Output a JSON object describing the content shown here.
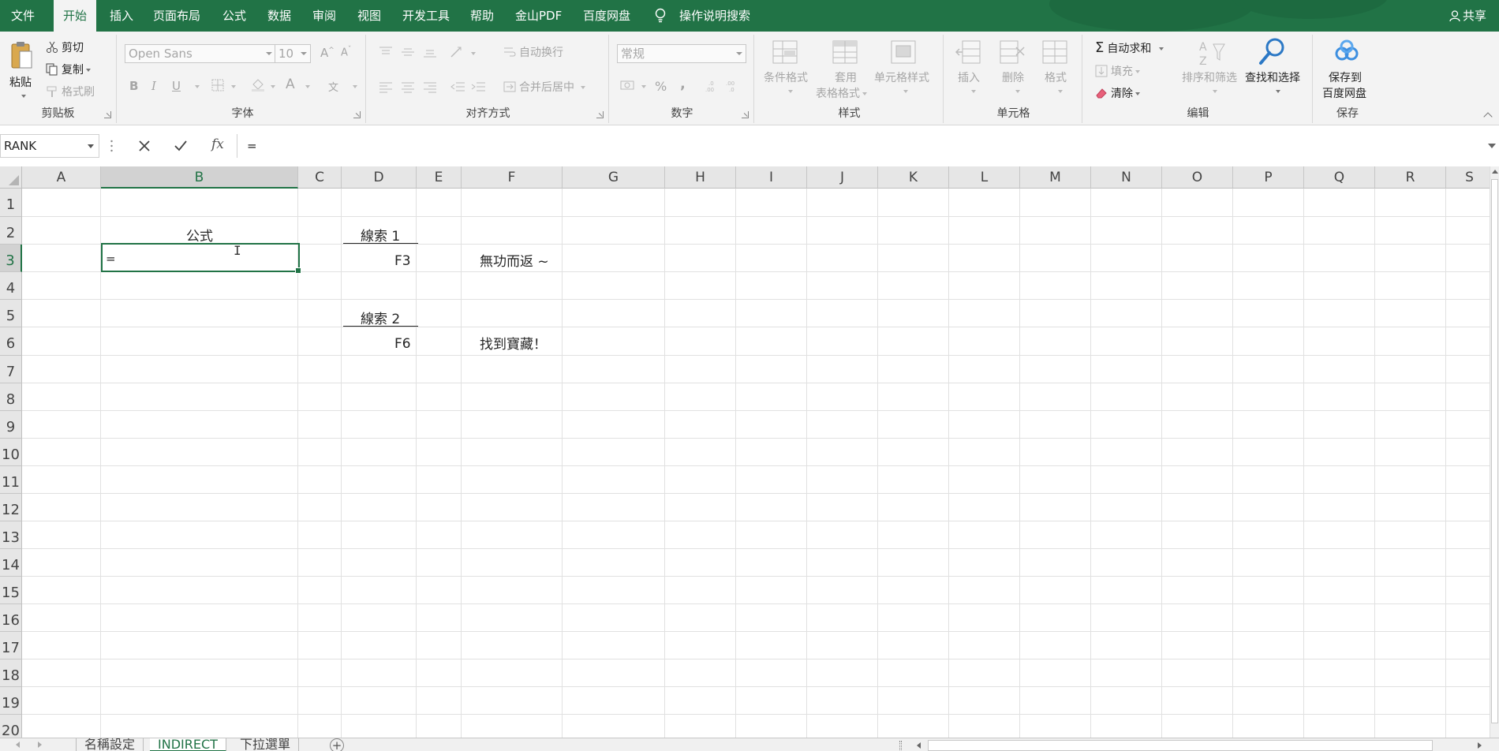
{
  "menu": {
    "items": [
      "文件",
      "开始",
      "插入",
      "页面布局",
      "公式",
      "数据",
      "审阅",
      "视图",
      "开发工具",
      "帮助",
      "金山PDF",
      "百度网盘"
    ],
    "active": "开始",
    "search": "操作说明搜索",
    "share": "共享"
  },
  "ribbon": {
    "clipboard": {
      "label": "剪贴板",
      "paste": "粘贴",
      "cut": "剪切",
      "copy": "复制",
      "format_painter": "格式刷"
    },
    "font": {
      "label": "字体",
      "font_name": "Open Sans",
      "font_size": "10",
      "bold": "B",
      "italic": "I",
      "underline": "U",
      "font_color": "A",
      "phonetic": "文"
    },
    "alignment": {
      "label": "对齐方式",
      "wrap_text": "自动换行",
      "merge_center": "合并后居中"
    },
    "number": {
      "label": "数字",
      "format": "常规",
      "percent": "%",
      "comma": ","
    },
    "styles": {
      "label": "样式",
      "conditional": "条件格式",
      "table_format_1": "套用",
      "table_format_2": "表格格式",
      "cell_styles": "单元格样式"
    },
    "cells": {
      "label": "单元格",
      "insert": "插入",
      "delete": "删除",
      "format": "格式"
    },
    "editing": {
      "label": "编辑",
      "autosum": "自动求和",
      "fill": "填充",
      "clear": "清除",
      "sort_filter": "排序和筛选",
      "find_select": "查找和选择"
    },
    "save": {
      "label": "保存",
      "save_to_1": "保存到",
      "save_to_2": "百度网盘"
    }
  },
  "formula_bar": {
    "name_box": "RANK",
    "fx": "fx",
    "content": "="
  },
  "columns": [
    "A",
    "B",
    "C",
    "D",
    "E",
    "F",
    "G",
    "H",
    "I",
    "J",
    "K",
    "L",
    "M",
    "N",
    "O",
    "P",
    "Q",
    "R",
    "S"
  ],
  "selected_column": "B",
  "rows": [
    "1",
    "2",
    "3",
    "4",
    "5",
    "6",
    "7",
    "8",
    "9",
    "10",
    "11",
    "12",
    "13",
    "14",
    "15",
    "16",
    "17",
    "18",
    "19",
    "20"
  ],
  "selected_row": "3",
  "cells": {
    "B2": "公式",
    "B3": "=",
    "D2": "線索 1",
    "D3": "F3",
    "D5": "線索 2",
    "D6": "F6",
    "F3": "無功而返 ~",
    "F6": "找到寶藏！"
  },
  "sheets": [
    "名稱設定",
    "INDIRECT",
    "下拉選單"
  ],
  "active_sheet": "INDIRECT",
  "colors": {
    "brand": "#217346",
    "ribbon_bg": "#f3f3f3",
    "header_bg": "#e6e6e6",
    "gridline": "#e1e1e1"
  }
}
